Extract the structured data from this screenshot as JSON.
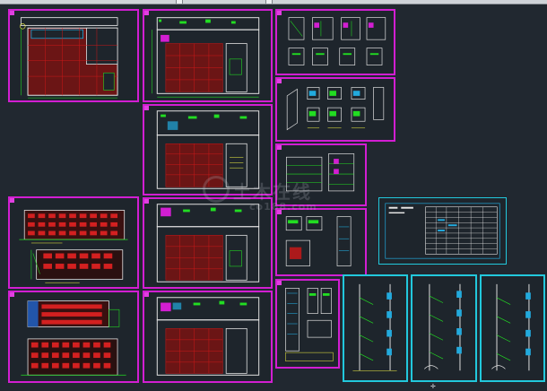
{
  "window": {
    "title": ""
  },
  "watermark": {
    "main": "土木在线",
    "sub": "co188.com"
  },
  "colors": {
    "background": "#212830",
    "sheet_frame": "#d21ed2",
    "sheet_frame_alt": "#22c8dc",
    "wall": "#e8e8e8",
    "axis": "#d01818",
    "dim": "#22dd22",
    "text": "#ffff44"
  },
  "sheets": [
    {
      "name": "site-plan"
    },
    {
      "name": "floor-plan-1"
    },
    {
      "name": "floor-plan-2"
    },
    {
      "name": "floor-plan-3"
    },
    {
      "name": "floor-plan-4"
    },
    {
      "name": "elevations-front"
    },
    {
      "name": "elevations-side"
    },
    {
      "name": "details-a"
    },
    {
      "name": "details-b"
    },
    {
      "name": "sections-a"
    },
    {
      "name": "sections-b"
    },
    {
      "name": "wall-section-a"
    },
    {
      "name": "stair-section-1"
    },
    {
      "name": "stair-section-2"
    },
    {
      "name": "stair-section-3"
    },
    {
      "name": "door-window-schedule"
    }
  ]
}
